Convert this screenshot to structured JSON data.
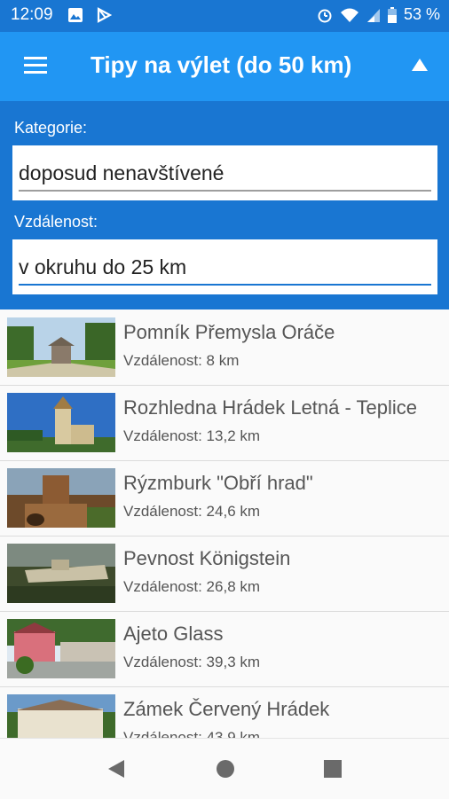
{
  "status": {
    "time": "12:09",
    "battery": "53 %"
  },
  "appbar": {
    "title": "Tipy na výlet (do 50 km)"
  },
  "filters": {
    "category_label": "Kategorie:",
    "category_value": "doposud nenavštívené",
    "distance_label": "Vzdálenost:",
    "distance_value": "v okruhu do 25 km"
  },
  "trips": [
    {
      "name": "Pomník Přemysla Oráče",
      "distance": "Vzdálenost: 8 km"
    },
    {
      "name": "Rozhledna Hrádek Letná - Teplice",
      "distance": "Vzdálenost: 13,2 km"
    },
    {
      "name": "Rýzmburk \"Obří hrad\"",
      "distance": "Vzdálenost: 24,6 km"
    },
    {
      "name": "Pevnost Königstein",
      "distance": "Vzdálenost: 26,8 km"
    },
    {
      "name": "Ajeto Glass",
      "distance": "Vzdálenost: 39,3 km"
    },
    {
      "name": "Zámek Červený Hrádek",
      "distance": "Vzdálenost: 43,9 km"
    }
  ],
  "icons": {
    "menu": "hamburger-icon",
    "collapse": "triangle-up-icon",
    "back": "triangle-left-icon",
    "home": "circle-icon",
    "recents": "square-icon"
  },
  "colors": {
    "status_bar": "#1976d2",
    "app_bar": "#2196f3",
    "filter_panel": "#1976d2"
  }
}
